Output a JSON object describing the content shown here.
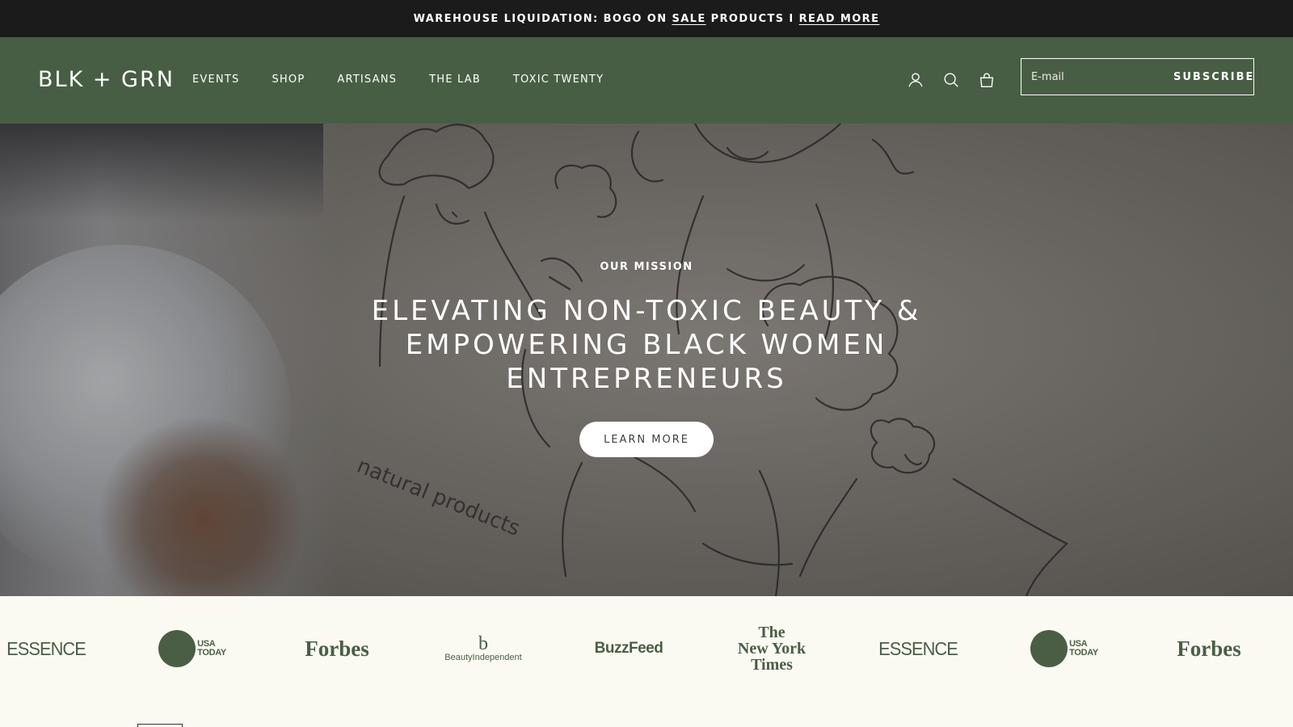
{
  "announcement": {
    "text_before": "WAREHOUSE LIQUIDATION: BOGO ON",
    "sale_link": "SALE",
    "text_after": "PRODUCTS I",
    "read_more_link": "READ MORE"
  },
  "header": {
    "logo": "BLK + GRN",
    "nav": [
      "EVENTS",
      "SHOP",
      "ARTISANS",
      "THE LAB",
      "TOXIC TWENTY"
    ],
    "icons": [
      "account-icon",
      "search-icon",
      "bag-icon"
    ],
    "subscribe": {
      "placeholder": "E-mail",
      "button_label": "SUBSCRIBE"
    }
  },
  "hero": {
    "eyebrow": "OUR MISSION",
    "headline": "ELEVATING NON-TOXIC BEAUTY & EMPOWERING BLACK WOMEN ENTREPRENEURS",
    "button_label": "LEARN MORE",
    "bag_print": "natural products"
  },
  "press_logos": [
    {
      "name": "ESSENCE"
    },
    {
      "name": "USA TODAY",
      "line1": "USA",
      "line2": "TODAY"
    },
    {
      "name": "Forbes"
    },
    {
      "name": "BeautyIndependent",
      "mark": "b",
      "word": "BeautyIndependent"
    },
    {
      "name": "BuzzFeed"
    },
    {
      "name": "The New York Times",
      "lines": [
        "The",
        "New York",
        "Times"
      ]
    },
    {
      "name": "ESSENCE"
    },
    {
      "name": "USA TODAY",
      "line1": "USA",
      "line2": "TODAY"
    },
    {
      "name": "Forbes"
    }
  ],
  "colors": {
    "announcement_bg": "#1b1b1b",
    "header_bg": "#485e44",
    "press_bg": "#fafaf2",
    "logo_green": "#4a5e46"
  }
}
